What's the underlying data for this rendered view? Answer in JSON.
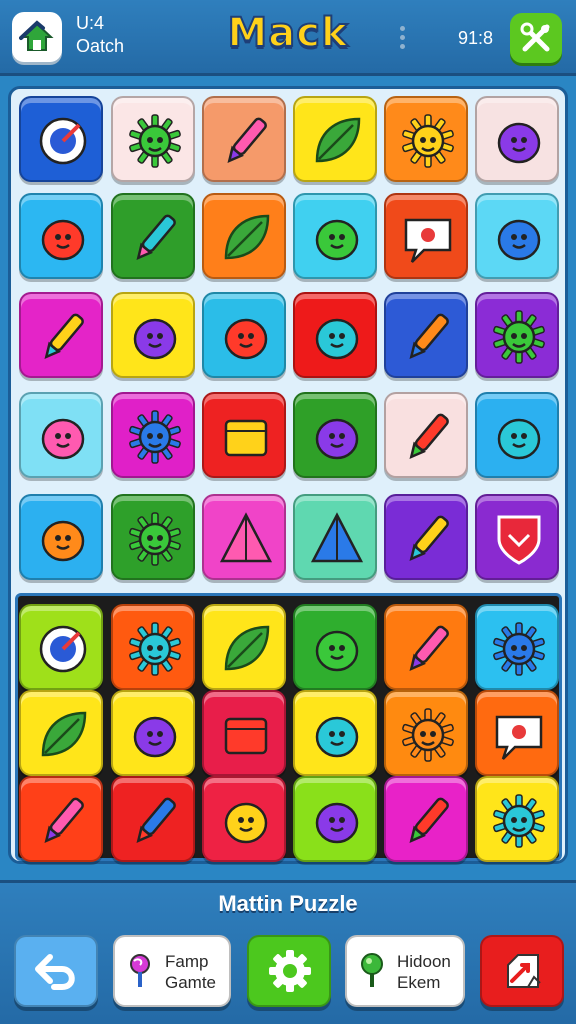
{
  "header": {
    "left_line1": "U:4",
    "left_line2": "Oatch",
    "title": "Mack",
    "score": "91:8"
  },
  "board": {
    "tiles": [
      {
        "color": "#1e5fd6",
        "icon": "target-icon"
      },
      {
        "color": "#fbe6e6",
        "icon": "flower-icon"
      },
      {
        "color": "#f59a6a",
        "icon": "pencil-icon"
      },
      {
        "color": "#ffe51a",
        "icon": "leaf-icon"
      },
      {
        "color": "#ff8a1a",
        "icon": "sun-icon"
      },
      {
        "color": "#f7e2e2",
        "icon": "fox-icon"
      },
      {
        "color": "#2cb7f2",
        "icon": "blob-face-icon"
      },
      {
        "color": "#2f9e2a",
        "icon": "crayon-icon"
      },
      {
        "color": "#ff7f1a",
        "icon": "sprig-icon"
      },
      {
        "color": "#40d0f0",
        "icon": "pink-creature-icon"
      },
      {
        "color": "#f04a1a",
        "icon": "speech-bubble-icon"
      },
      {
        "color": "#5cd8f5",
        "icon": "blue-creature-icon"
      },
      {
        "color": "#e424c8",
        "icon": "carrot-icon"
      },
      {
        "color": "#ffe51a",
        "icon": "green-bug-icon"
      },
      {
        "color": "#2bbde8",
        "icon": "radish-icon"
      },
      {
        "color": "#ee1a1a",
        "icon": "orange-monster-icon"
      },
      {
        "color": "#2d5ad6",
        "icon": "crossed-sticks-icon"
      },
      {
        "color": "#8b2cd6",
        "icon": "star-face-icon"
      },
      {
        "color": "#7fe0f5",
        "icon": "berry-icon"
      },
      {
        "color": "#e020c8",
        "icon": "spiky-ball-icon"
      },
      {
        "color": "#ee2222",
        "icon": "red-box-icon"
      },
      {
        "color": "#2fa028",
        "icon": "cherry-sprout-icon"
      },
      {
        "color": "#f9e0e0",
        "icon": "syringe-icon"
      },
      {
        "color": "#2cb0f0",
        "icon": "yellow-creature-icon"
      },
      {
        "color": "#2cb0f0",
        "icon": "acorn-face-icon"
      },
      {
        "color": "#2ea02a",
        "icon": "gear-flower-icon"
      },
      {
        "color": "#f044c8",
        "icon": "flame-icon"
      },
      {
        "color": "#5fd8b0",
        "icon": "triangle-icon"
      },
      {
        "color": "#7a2cd6",
        "icon": "scissors-icon"
      },
      {
        "color": "#8a2ad0",
        "icon": "shield-icon"
      },
      {
        "color": "#9fe01a",
        "icon": "compass-icon"
      },
      {
        "color": "#ff5a10",
        "icon": "sun-face-icon"
      },
      {
        "color": "#ffe51a",
        "icon": "leaf-icon"
      },
      {
        "color": "#2fae2e",
        "icon": "blue-splat-icon"
      },
      {
        "color": "#ff7a10",
        "icon": "paintbrush-icon"
      },
      {
        "color": "#2cc0f0",
        "icon": "red-spiky-icon"
      },
      {
        "color": "#ffe51a",
        "icon": "green-leaf-icon"
      },
      {
        "color": "#ffe51a",
        "icon": "eraser-icon"
      },
      {
        "color": "#e81e4a",
        "icon": "picture-card-icon"
      },
      {
        "color": "#ffe51a",
        "icon": "green-fish-icon"
      },
      {
        "color": "#ff8a10",
        "icon": "sun-face-icon"
      },
      {
        "color": "#ff6a10",
        "icon": "chat-bubble-icon"
      },
      {
        "color": "#ff4018",
        "icon": "carrot-icon"
      },
      {
        "color": "#ee2222",
        "icon": "blue-bottle-icon"
      },
      {
        "color": "#ee2244",
        "icon": "lemon-icon"
      },
      {
        "color": "#8ae01a",
        "icon": "blue-egg-icon"
      },
      {
        "color": "#e822c8",
        "icon": "blue-syringe-icon"
      },
      {
        "color": "#ffe51a",
        "icon": "blue-spiky-icon"
      }
    ]
  },
  "footer": {
    "title": "Mattin Puzzle",
    "buttons": [
      {
        "icon": "undo-icon",
        "color": "#5ab0f0"
      },
      {
        "icon": "lollipop-icon",
        "color": "#ffffff",
        "label_line1": "Famp",
        "label_line2": "Gamte"
      },
      {
        "icon": "gear-icon",
        "color": "#4cc81e"
      },
      {
        "icon": "green-pin-icon",
        "color": "#ffffff",
        "label_line1": "Hidoon",
        "label_line2": "Ekem"
      },
      {
        "icon": "broken-card-icon",
        "color": "#e81e1e"
      }
    ]
  }
}
